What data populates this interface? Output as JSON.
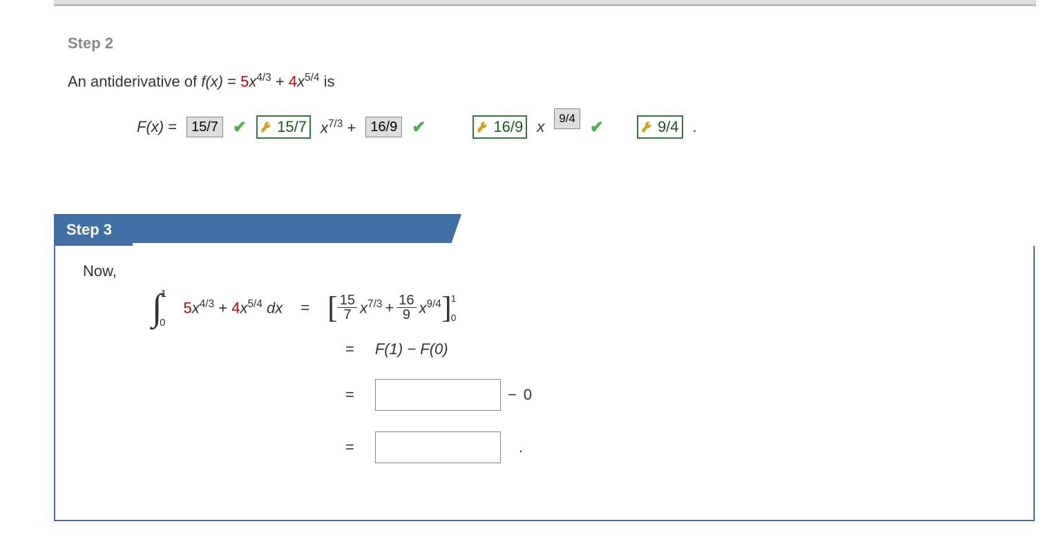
{
  "step2": {
    "title": "Step 2",
    "text_prefix": "An antiderivative of  ",
    "fx_label": "f(x)",
    "eq": " = ",
    "term1_coef": "5",
    "term1_var": "x",
    "term1_exp": "4/3",
    "plus": " + ",
    "term2_coef": "4",
    "term2_var": "x",
    "term2_exp": "5/4",
    "text_suffix": "  is"
  },
  "eq2": {
    "Fx_label": "F(x)",
    "eq": " = ",
    "box1": "15/7",
    "key1": "15/7",
    "mid_var": "x",
    "mid_exp": "7/3",
    "plus": " + ",
    "box2": "16/9",
    "key2": "16/9",
    "tail_var": "x",
    "box3": "9/4",
    "key3": "9/4",
    "period": "."
  },
  "step3": {
    "title": "Step 3",
    "now": "Now,"
  },
  "eq3": {
    "int_upper": "1",
    "int_lower": "0",
    "integrand_t1_coef": "5",
    "integrand_t1_var": "x",
    "integrand_t1_exp": "4/3",
    "plus": " + ",
    "integrand_t2_coef": "4",
    "integrand_t2_var": "x",
    "integrand_t2_exp": "5/4",
    "dx": " dx",
    "eq": "=",
    "rhs_t1_num": "15",
    "rhs_t1_den": "7",
    "rhs_t1_var": "x",
    "rhs_t1_exp": "7/3",
    "rhs_plus": " + ",
    "rhs_t2_num": "16",
    "rhs_t2_den": "9",
    "rhs_t2_var": "x",
    "rhs_t2_exp": "9/4",
    "bracket_upper": "1",
    "bracket_lower": "0"
  },
  "eq4": {
    "eq": "=",
    "text": "F(1) − F(0)"
  },
  "eq5": {
    "eq": "=",
    "minus": " − ",
    "zero": "0"
  },
  "eq6": {
    "eq": "=",
    "period": "."
  }
}
